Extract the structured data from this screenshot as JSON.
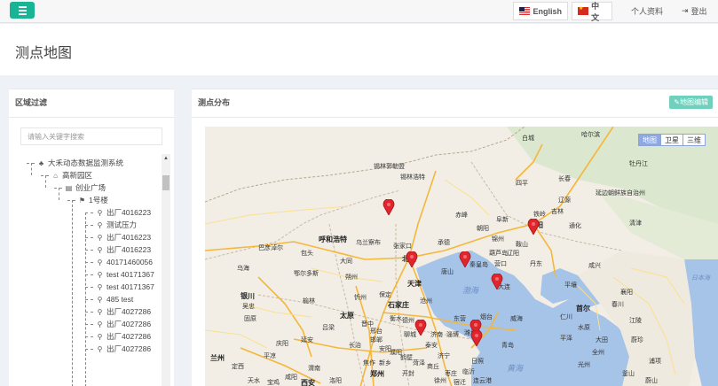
{
  "topbar": {
    "lang_en": "English",
    "lang_zh": "中文",
    "profile": "个人资料",
    "logout": "登出"
  },
  "page": {
    "title": "测点地图"
  },
  "filter_panel": {
    "title": "区域过滤",
    "search_placeholder": "请输入关键字搜索",
    "tree": [
      {
        "label": "大禾动态数据监测系统",
        "icon": "sitemap-icon"
      },
      {
        "label": "高新园区",
        "icon": "home-icon"
      },
      {
        "label": "创业广场",
        "icon": "table-icon"
      },
      {
        "label": "1号楼",
        "icon": "flag-icon"
      },
      {
        "label": "出厂4016223",
        "icon": "map-marker-icon"
      },
      {
        "label": "测试压力",
        "icon": "map-marker-icon"
      },
      {
        "label": "出厂4016223",
        "icon": "map-marker-icon"
      },
      {
        "label": "出厂4016223",
        "icon": "map-marker-icon"
      },
      {
        "label": "40171460056",
        "icon": "map-marker-icon"
      },
      {
        "label": "test 40171367",
        "icon": "map-marker-icon"
      },
      {
        "label": "test 40171367",
        "icon": "map-marker-icon"
      },
      {
        "label": "485 test",
        "icon": "map-marker-icon"
      },
      {
        "label": "出厂4027286",
        "icon": "map-marker-icon"
      },
      {
        "label": "出厂4027286",
        "icon": "map-marker-icon"
      },
      {
        "label": "出厂4027286",
        "icon": "map-marker-icon"
      },
      {
        "label": "出厂4027286",
        "icon": "map-marker-icon"
      }
    ]
  },
  "map_panel": {
    "title": "测点分布",
    "edit_button": "地图编辑",
    "map_types": [
      "地图",
      "卫星",
      "三维"
    ],
    "seas": [
      "渤海",
      "黄海"
    ],
    "cities": [
      "哈尔滨",
      "白城",
      "牡丹江",
      "锡林郭勒盟",
      "锡林浩特",
      "长春",
      "延边朝鲜族自治州",
      "四平",
      "辽源",
      "通化",
      "吉林",
      "铁岭",
      "沈阳",
      "阜新",
      "赤峰",
      "朝阳",
      "锦州",
      "呼和浩特",
      "乌兰察布",
      "张家口",
      "承德",
      "巴彦淖尔",
      "包头",
      "大同",
      "北京",
      "秦皇岛",
      "葫芦岛",
      "鞍山",
      "丹东",
      "辽阳",
      "营口",
      "天津",
      "唐山",
      "大连",
      "平壤",
      "清津",
      "咸兴",
      "鄂尔多斯",
      "乌海",
      "朔州",
      "忻州",
      "保定",
      "沧州",
      "银川",
      "吴忠",
      "固原",
      "榆林",
      "太原",
      "石家庄",
      "衡水",
      "德州",
      "东营",
      "烟台",
      "威海",
      "潍坊",
      "青岛",
      "济南",
      "淄博",
      "日照",
      "临沂",
      "泰安",
      "邢台",
      "邯郸",
      "聊城",
      "延安",
      "吕梁",
      "晋中",
      "长治",
      "濮阳",
      "新乡",
      "安阳",
      "鹤壁",
      "郑州",
      "开封",
      "焦作",
      "洛阳",
      "渭南",
      "商丘",
      "菏泽",
      "济宁",
      "枣庄",
      "连云港",
      "宿迁",
      "徐州",
      "兰州",
      "定西",
      "平凉",
      "庆阳",
      "天水",
      "宝鸡",
      "咸阳",
      "西安",
      "大田",
      "全州",
      "光州",
      "釜山",
      "蔚山",
      "浦项",
      "首尔",
      "仁川",
      "水原",
      "蔚珍",
      "江陵",
      "春川",
      "襄阳",
      "平泽",
      "日本海"
    ]
  },
  "colors": {
    "accent": "#1ab394",
    "marker": "#e0262d",
    "water": "#a6c3e8"
  }
}
